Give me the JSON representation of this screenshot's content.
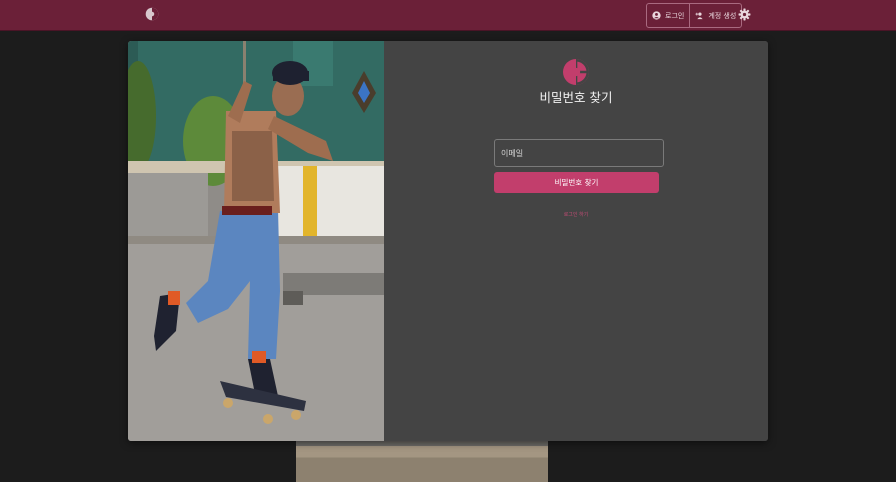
{
  "header": {
    "login_label": "로그인",
    "signup_label": "계정 생성",
    "icons": [
      "brand-logo-icon",
      "user-circle-icon",
      "add-user-icon",
      "gear-icon"
    ]
  },
  "form": {
    "title": "비밀번호 찾기",
    "email_placeholder": "이메일",
    "submit_label": "비밀번호 찾기",
    "back_link": "로그인 하기"
  },
  "colors": {
    "topbar": "#6b2038",
    "accent": "#c23e6c",
    "panel": "#444444",
    "background": "#1c1c1c"
  }
}
